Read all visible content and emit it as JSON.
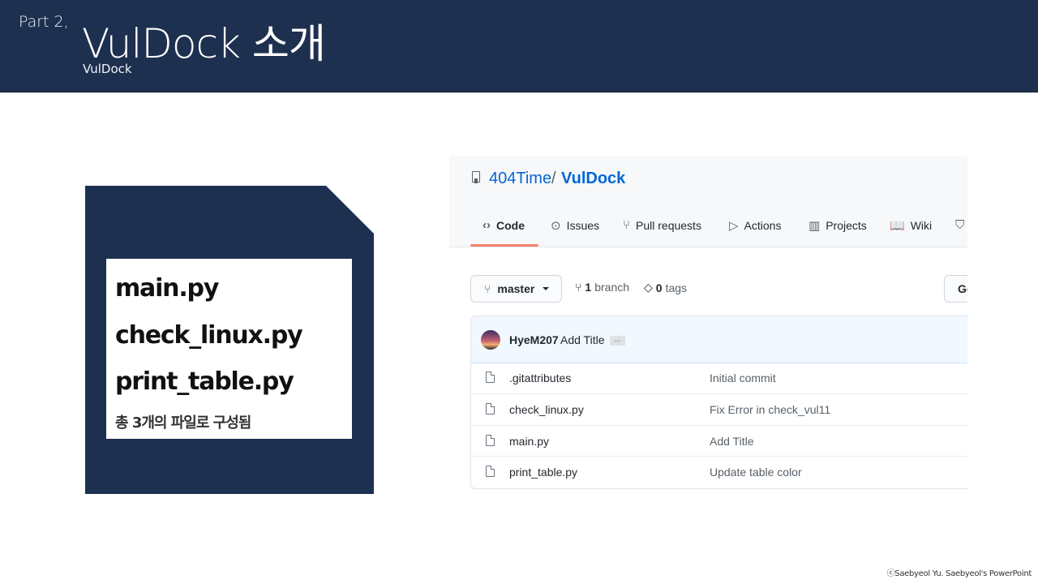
{
  "header": {
    "part_label": "Part 2,",
    "title": "VulDock 소개",
    "subtitle": "VulDock",
    "background": "#1e3050"
  },
  "card": {
    "files": [
      "main.py",
      "check_linux.py",
      "print_table.py"
    ],
    "caption": "총 3개의 파일로 구성됨"
  },
  "github": {
    "owner": "404Time",
    "separator": "/",
    "repo": "VulDock",
    "tabs": [
      {
        "label": "Code",
        "icon": "code-icon",
        "glyph": "‹›"
      },
      {
        "label": "Issues",
        "icon": "issue-icon",
        "glyph": "⊙"
      },
      {
        "label": "Pull requests",
        "icon": "pull-request-icon",
        "glyph": "⑂"
      },
      {
        "label": "Actions",
        "icon": "play-icon",
        "glyph": "▷"
      },
      {
        "label": "Projects",
        "icon": "project-icon",
        "glyph": "▥"
      },
      {
        "label": "Wiki",
        "icon": "book-icon",
        "glyph": "📖"
      }
    ],
    "branch_selector": "master",
    "branch_count": "1",
    "branch_word": "branch",
    "tag_count": "0",
    "tag_word": "tags",
    "goto_label": "Go",
    "latest_commit": {
      "author": "HyeM207",
      "message": "Add Title",
      "ellipsis": "..."
    },
    "files": [
      {
        "name": ".gitattributes",
        "commit": "Initial commit"
      },
      {
        "name": "check_linux.py",
        "commit": "Fix Error in check_vul11"
      },
      {
        "name": "main.py",
        "commit": "Add Title"
      },
      {
        "name": "print_table.py",
        "commit": "Update table color"
      }
    ]
  },
  "footer": {
    "credit": "ⓒSaebyeol Yu. Saebyeol's PowerPoint"
  }
}
